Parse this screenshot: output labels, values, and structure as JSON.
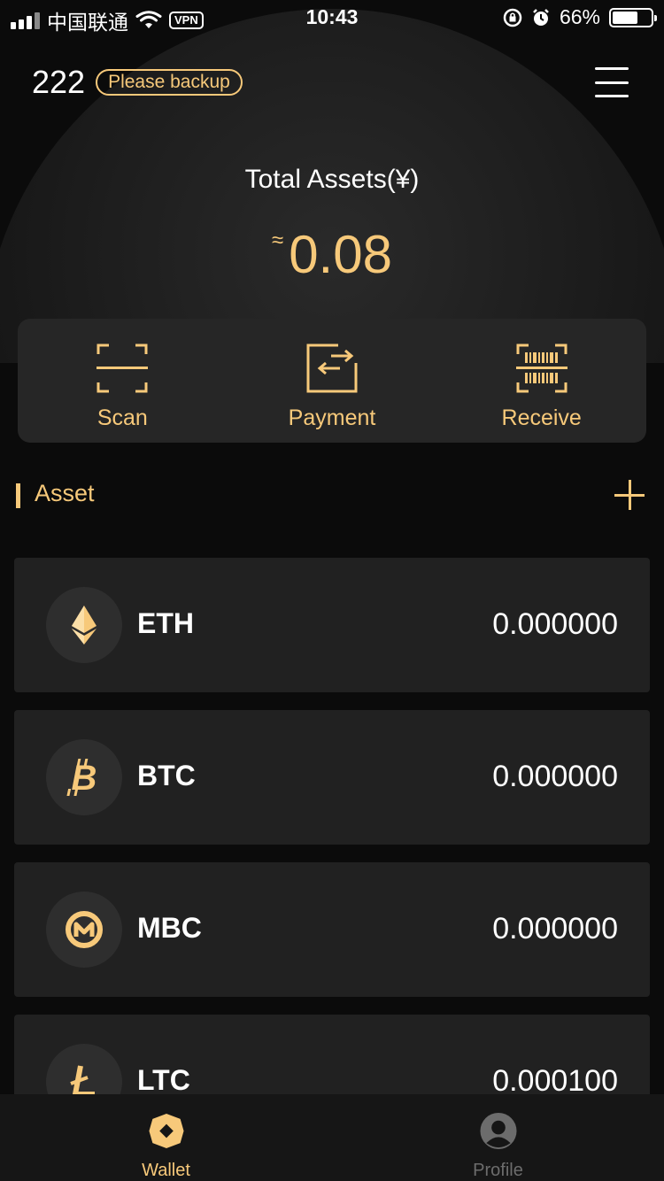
{
  "status_bar": {
    "carrier": "中国联通",
    "vpn": "VPN",
    "time": "10:43",
    "battery": "66%",
    "battery_level": 0.66
  },
  "header": {
    "wallet_name": "222",
    "backup_label": "Please backup",
    "menu_icon": "hamburger-menu-icon"
  },
  "summary": {
    "total_label": "Total Assets(¥)",
    "approx_symbol": "≈",
    "total_value": "0.08"
  },
  "actions": [
    {
      "label": "Scan",
      "icon": "scan-icon"
    },
    {
      "label": "Payment",
      "icon": "payment-icon"
    },
    {
      "label": "Receive",
      "icon": "receive-icon"
    }
  ],
  "asset_section": {
    "title": "Asset",
    "add_icon": "plus-icon"
  },
  "assets": [
    {
      "symbol": "ETH",
      "balance": "0.000000",
      "icon": "eth-icon"
    },
    {
      "symbol": "BTC",
      "balance": "0.000000",
      "icon": "btc-icon"
    },
    {
      "symbol": "MBC",
      "balance": "0.000000",
      "icon": "mbc-icon"
    },
    {
      "symbol": "LTC",
      "balance": "0.000100",
      "icon": "ltc-icon"
    }
  ],
  "tabs": [
    {
      "label": "Wallet",
      "icon": "wallet-icon",
      "active": true
    },
    {
      "label": "Profile",
      "icon": "profile-icon",
      "active": false
    }
  ],
  "colors": {
    "accent": "#f7c97a",
    "background": "#0b0b0b",
    "card": "#212121",
    "action_panel": "#262626"
  }
}
